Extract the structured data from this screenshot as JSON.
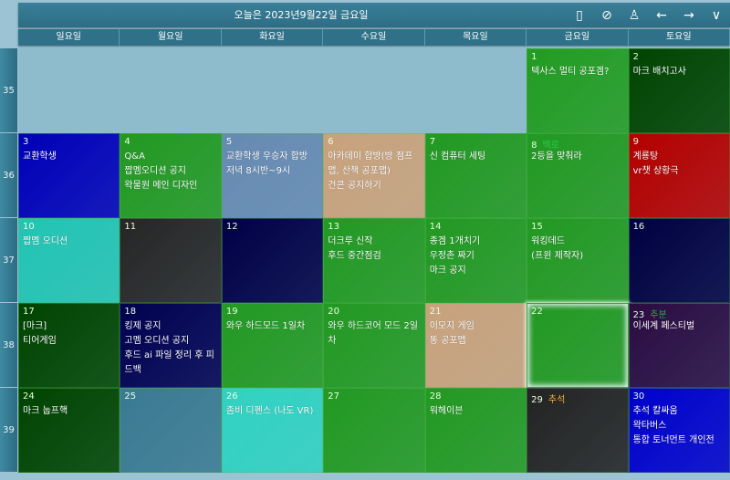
{
  "header": {
    "title": "오늘은 2023년9월22일 금요일",
    "icons": [
      "phone-icon",
      "cloud-check-icon",
      "user-icon",
      "arrow-left-icon",
      "arrow-right-icon",
      "chevron-down-icon"
    ]
  },
  "weekdays": [
    "일요일",
    "월요일",
    "화요일",
    "수요일",
    "목요일",
    "금요일",
    "토요일"
  ],
  "weeks": [
    "35",
    "36",
    "37",
    "38",
    "39"
  ],
  "today": "22",
  "cells": [
    {
      "day": "1",
      "color": "#229c22",
      "events": [
        "텍사스 멀티 공포겜?"
      ]
    },
    {
      "day": "2",
      "color": "#004400",
      "events": [
        "마크 배치고사"
      ]
    },
    {
      "day": "3",
      "color": "#0000b8",
      "events": [
        "교환학생"
      ]
    },
    {
      "day": "4",
      "color": "#229922",
      "events": [
        "Q&A",
        "짭멤오디션 공지",
        "왁물원 메인 디자인"
      ]
    },
    {
      "day": "5",
      "color": "#668ab2",
      "events": [
        "교환학생 우승자 합방",
        "저녁 8시반~9시"
      ]
    },
    {
      "day": "6",
      "color": "#c9a27c",
      "events": [
        "아카데미 합방(방 점프맵, 산책 공포맵)",
        "건콘 공지하기"
      ]
    },
    {
      "day": "7",
      "color": "#229922",
      "events": [
        "신 컴퓨터 세팅"
      ]
    },
    {
      "day": "8",
      "color": "#229922",
      "holiday": "백로",
      "holiday_color": "#22cc44",
      "events": [
        "2등을 맞춰라"
      ]
    },
    {
      "day": "9",
      "color": "#b40000",
      "events": [
        "계룡탕",
        "vr챗 상황극"
      ]
    },
    {
      "day": "10",
      "color": "#22c4b4",
      "events": [
        "짭멤 오디션"
      ]
    },
    {
      "day": "11",
      "color": "#262626",
      "events": []
    },
    {
      "day": "12",
      "color": "#000046",
      "events": []
    },
    {
      "day": "13",
      "color": "#229922",
      "events": [
        "더크루 신작",
        "후드 중간점검"
      ]
    },
    {
      "day": "14",
      "color": "#229922",
      "events": [
        "종겜 1개치기",
        "우정촌 짜기",
        "마크 공지"
      ]
    },
    {
      "day": "15",
      "color": "#229922",
      "events": [
        "워킹데드",
        "(프윈 제작자)"
      ]
    },
    {
      "day": "16",
      "color": "#000040",
      "events": []
    },
    {
      "day": "17",
      "color": "#004400",
      "events": [
        "[마크]",
        "티어게임"
      ]
    },
    {
      "day": "18",
      "color": "#000050",
      "events": [
        "킹제 공지",
        "고멤 오디션 공지",
        "후드 ai 파일 정리 후 피드백"
      ]
    },
    {
      "day": "19",
      "color": "#229922",
      "events": [
        "와우 하드모드 1일차"
      ]
    },
    {
      "day": "20",
      "color": "#229922",
      "events": [
        "와우 하드코어 모드 2일차"
      ]
    },
    {
      "day": "21",
      "color": "#c9a27c",
      "events": [
        "이모지 게임",
        "똥 공포맵"
      ]
    },
    {
      "day": "22",
      "color": "#229922",
      "events": []
    },
    {
      "day": "23",
      "color": "#2a0c42",
      "holiday": "추분",
      "holiday_color": "#22aa44",
      "events": [
        "이세계 페스티벌"
      ]
    },
    {
      "day": "24",
      "color": "#004400",
      "events": [
        "마크 눕프핵"
      ]
    },
    {
      "day": "25",
      "color": "#3a7a92",
      "events": []
    },
    {
      "day": "26",
      "color": "#30d2c2",
      "events": [
        "좀비 디펜스 (나도 VR)"
      ]
    },
    {
      "day": "27",
      "color": "#229922",
      "events": []
    },
    {
      "day": "28",
      "color": "#229922",
      "events": [
        "워헤이븐"
      ]
    },
    {
      "day": "29",
      "color": "#232323",
      "holiday": "추석",
      "holiday_color": "#f0b030",
      "events": []
    },
    {
      "day": "30",
      "color": "#0000cc",
      "events": [
        "추석 칼싸움",
        "왁타버스",
        "통합 토너먼트 개인전"
      ]
    }
  ]
}
